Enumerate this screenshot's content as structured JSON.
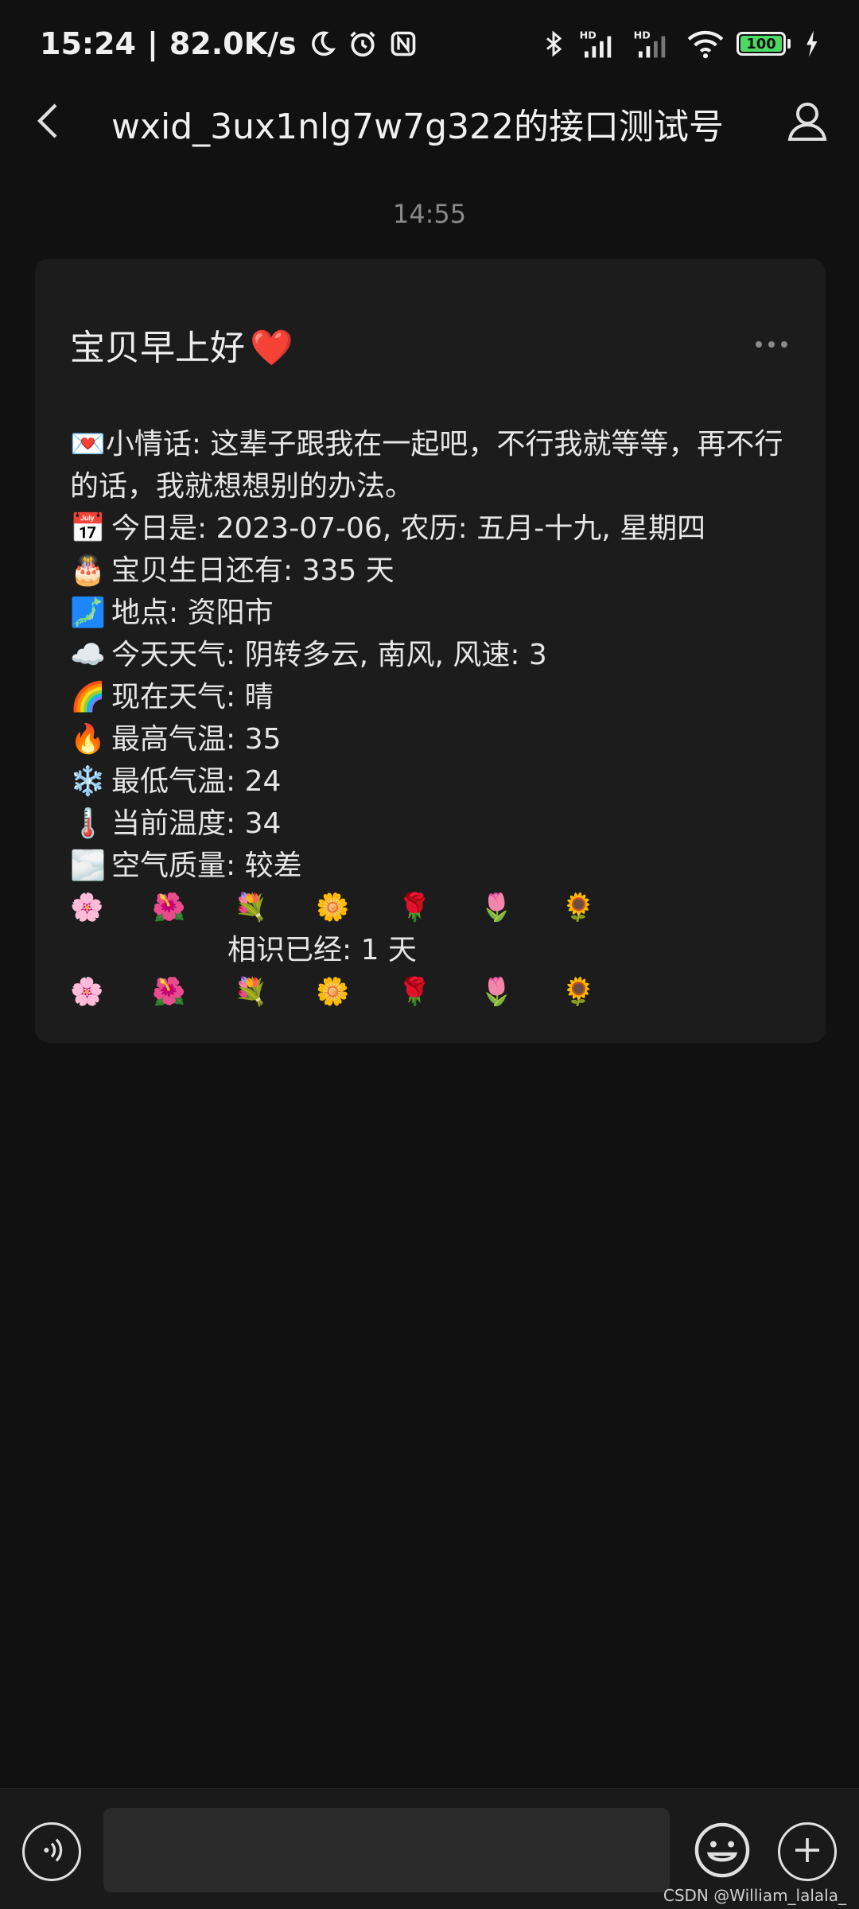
{
  "status_bar": {
    "time": "15:24",
    "separator": "|",
    "net_speed": "82.0K/s",
    "battery": "100",
    "icons": [
      "moon-icon",
      "alarm-icon",
      "nfc-icon",
      "bluetooth-icon",
      "signal-hd-icon",
      "signal-hd-icon",
      "wifi-icon",
      "battery-icon",
      "charging-icon"
    ]
  },
  "header": {
    "title": "wxid_3ux1nlg7w7g322的接口测试号",
    "back_icon": "chevron-left-icon",
    "profile_icon": "person-icon"
  },
  "chat": {
    "timestamp": "14:55",
    "card": {
      "title": "宝贝早上好",
      "title_emoji": "❤️",
      "more_icon": "more-dots-icon",
      "lines": [
        {
          "emoji": "💌",
          "text": "小情话: 这辈子跟我在一起吧，不行我就等等，再不行的话，我就想想别的办法。"
        },
        {
          "emoji": "📅",
          "text": "今日是: 2023-07-06, 农历: 五月-十九, 星期四"
        },
        {
          "emoji": "🎂",
          "text": "宝贝生日还有: 335 天"
        },
        {
          "emoji": "🗾",
          "text": "地点: 资阳市"
        },
        {
          "emoji": "☁️",
          "text": "今天天气: 阴转多云, 南风, 风速: 3"
        },
        {
          "emoji": "🌈",
          "text": "现在天气: 晴"
        },
        {
          "emoji": "🔥",
          "text": "最高气温: 35"
        },
        {
          "emoji": "❄️",
          "text": "最低气温: 24"
        },
        {
          "emoji": "🌡️",
          "text": "当前温度: 34"
        },
        {
          "emoji": "🌫️",
          "text": "空气质量: 较差"
        }
      ],
      "flowers": [
        "🌸",
        "🌺",
        "💐",
        "🌼",
        "🌹",
        "🌷",
        "🌻"
      ],
      "together_text": "相识已经: 1 天"
    }
  },
  "input_bar": {
    "voice_icon": "voice-icon",
    "input_value": "",
    "emoji_icon": "emoji-icon",
    "plus_icon": "plus-icon"
  },
  "watermark": "CSDN @William_lalala_"
}
